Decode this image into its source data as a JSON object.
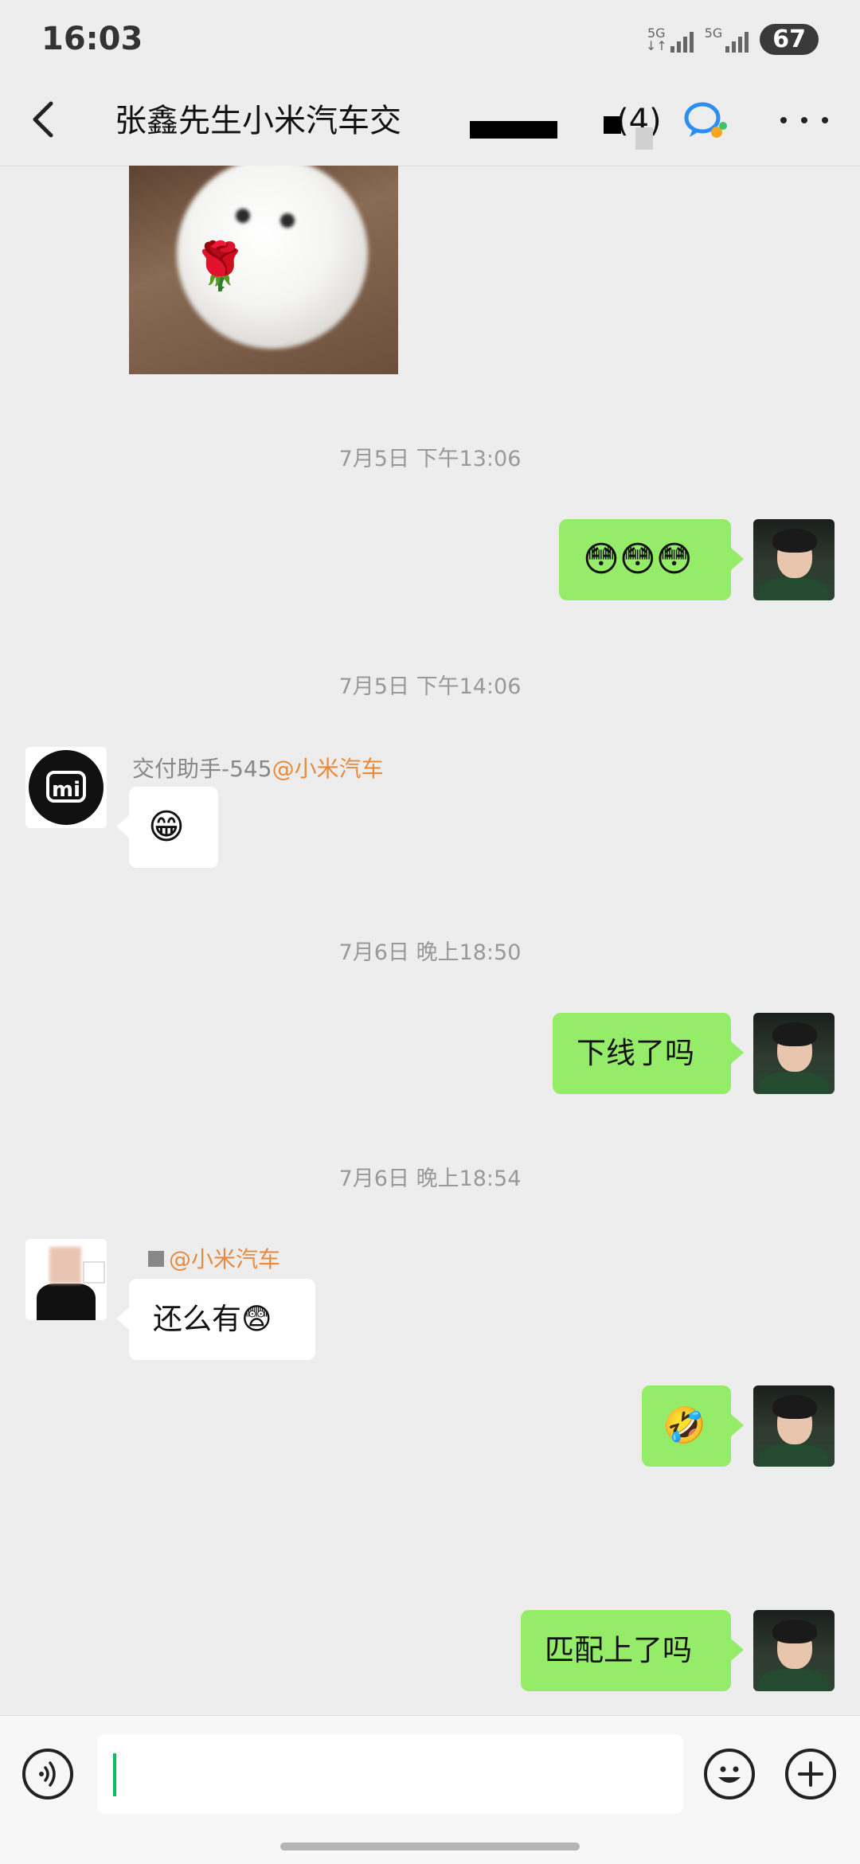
{
  "status_bar": {
    "time": "16:03",
    "network_1": "5G",
    "network_2": "5G",
    "battery": "67"
  },
  "header": {
    "title": "张鑫先生小米汽车交",
    "member_count": "(4)"
  },
  "messages": [
    {
      "type": "image",
      "side": "right",
      "alt": ""
    },
    {
      "type": "timestamp",
      "text": "7月5日 下午13:06"
    },
    {
      "type": "text",
      "side": "right",
      "text": "😳😳😳"
    },
    {
      "type": "timestamp",
      "text": "7月5日 下午14:06"
    },
    {
      "type": "text",
      "side": "left",
      "sender": "交付助手-545",
      "sender_org": "@小米汽车",
      "text": "😁"
    },
    {
      "type": "timestamp",
      "text": "7月6日 晚上18:50"
    },
    {
      "type": "text",
      "side": "right",
      "text": "下线了吗"
    },
    {
      "type": "timestamp",
      "text": "7月6日 晚上18:54"
    },
    {
      "type": "text",
      "side": "left",
      "sender": "",
      "sender_org": "@小米汽车",
      "text": "还么有😨"
    },
    {
      "type": "text",
      "side": "right",
      "text": "🤣"
    },
    {
      "type": "text",
      "side": "right",
      "text": "匹配上了吗"
    }
  ],
  "input_bar": {
    "voice_icon": "voice-icon",
    "emoji_icon": "emoji-icon",
    "plus_icon": "plus-icon",
    "value": ""
  },
  "colors": {
    "background": "#ededed",
    "bubble_self": "#95ec69",
    "bubble_other": "#ffffff",
    "sender_org": "#e88a3c",
    "caret": "#07c160"
  }
}
